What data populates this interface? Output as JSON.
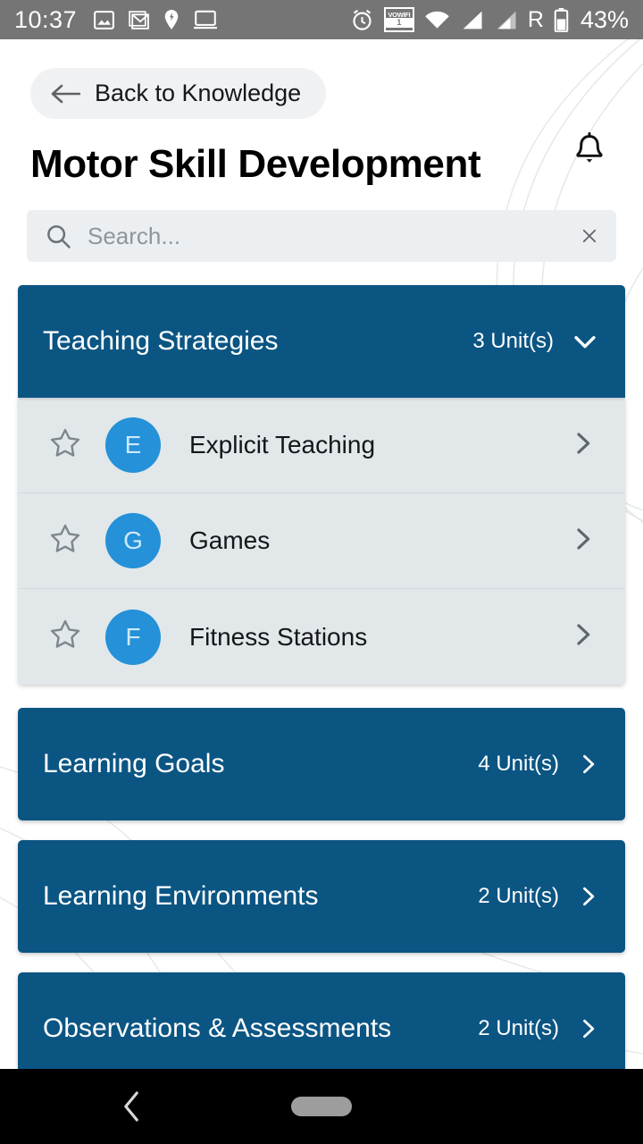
{
  "statusbar": {
    "time": "10:37",
    "battery_percent": "43%",
    "roaming_label": "R",
    "vowifi_label": "VOWIFI",
    "vowifi_sub": "1",
    "left_icons": [
      "photos-icon",
      "gmail-icon",
      "location-pin-icon",
      "cast-screen-icon"
    ],
    "right_icons": [
      "alarm-icon",
      "vowifi-icon",
      "wifi-icon",
      "signal-bars-icon",
      "signal-bars-2-icon",
      "roaming-icon",
      "battery-icon"
    ],
    "background_color": "#757575"
  },
  "header": {
    "back_label": "Back to Knowledge",
    "back_icon": "arrow-left-icon",
    "notification_icon": "bell-icon",
    "title": "Motor Skill Development"
  },
  "search": {
    "placeholder": "Search...",
    "value": "",
    "search_icon": "search-icon",
    "clear_icon": "close-icon"
  },
  "theme": {
    "primary_blue": "#0b5583",
    "avatar_blue": "#2491d8",
    "row_background": "#e2e7ea",
    "search_background": "#eceff1",
    "pill_background": "#f0f1f3"
  },
  "accordion": {
    "groups": [
      {
        "title": "Teaching Strategies",
        "count_label": "3 Unit(s)",
        "expanded": true,
        "chevron": "chevron-down-icon",
        "units": [
          {
            "title": "Explicit Teaching",
            "initial": "E",
            "starred": false
          },
          {
            "title": "Games",
            "initial": "G",
            "starred": false
          },
          {
            "title": "Fitness Stations",
            "initial": "F",
            "starred": false
          }
        ]
      },
      {
        "title": "Learning Goals",
        "count_label": "4 Unit(s)",
        "expanded": false,
        "chevron": "chevron-right-icon",
        "units": []
      },
      {
        "title": "Learning Environments",
        "count_label": "2 Unit(s)",
        "expanded": false,
        "chevron": "chevron-right-icon",
        "units": []
      },
      {
        "title": "Observations & Assessments",
        "count_label": "2 Unit(s)",
        "expanded": false,
        "chevron": "chevron-right-icon",
        "units": []
      }
    ]
  },
  "navbar": {
    "back_icon": "nav-back-icon",
    "home_icon": "nav-home-pill"
  }
}
